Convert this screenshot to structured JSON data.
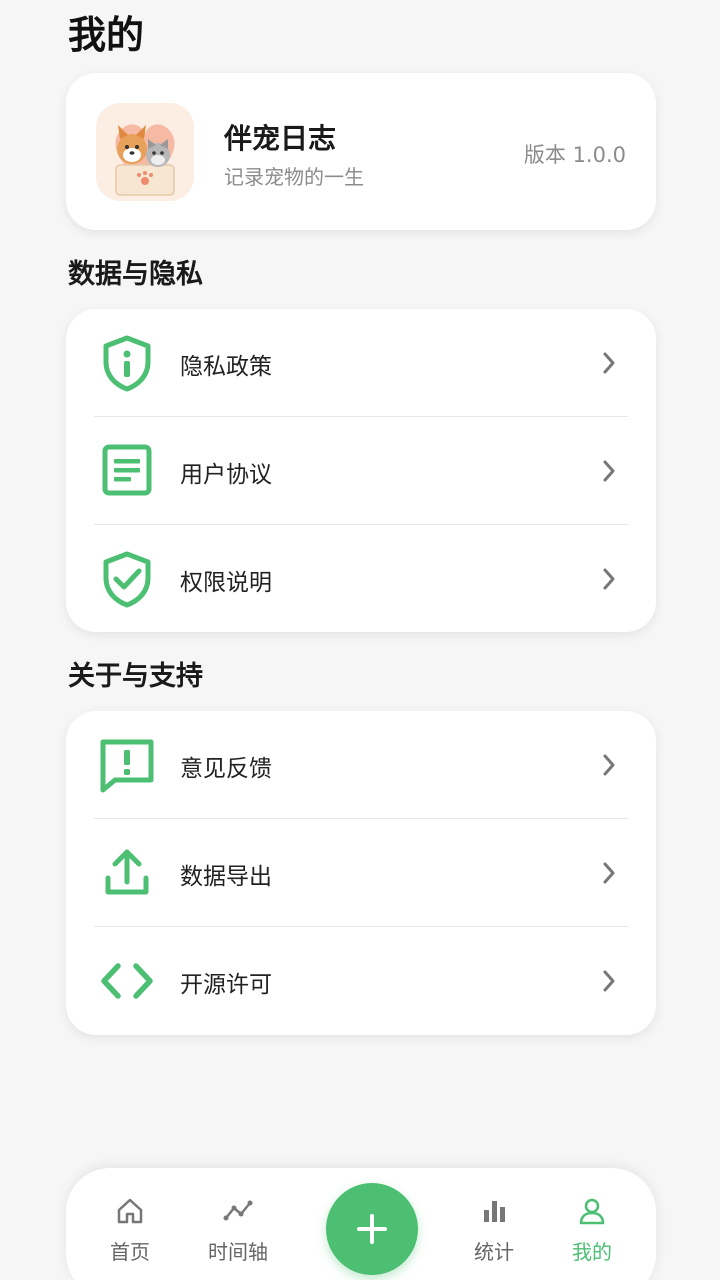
{
  "page": {
    "title": "我的"
  },
  "app_info": {
    "name": "伴宠日志",
    "slogan": "记录宠物的一生",
    "version": "版本 1.0.0"
  },
  "sections": [
    {
      "title": "数据与隐私",
      "items": [
        {
          "label": "隐私政策",
          "icon": "shield-info-icon"
        },
        {
          "label": "用户协议",
          "icon": "document-icon"
        },
        {
          "label": "权限说明",
          "icon": "shield-check-icon"
        }
      ]
    },
    {
      "title": "关于与支持",
      "items": [
        {
          "label": "意见反馈",
          "icon": "feedback-icon"
        },
        {
          "label": "数据导出",
          "icon": "upload-icon"
        },
        {
          "label": "开源许可",
          "icon": "code-icon"
        }
      ]
    }
  ],
  "tabbar": {
    "items": [
      {
        "label": "首页",
        "icon": "home-icon"
      },
      {
        "label": "时间轴",
        "icon": "trend-icon"
      },
      {
        "label": "",
        "icon": "plus-icon"
      },
      {
        "label": "统计",
        "icon": "bar-chart-icon"
      },
      {
        "label": "我的",
        "icon": "user-icon"
      }
    ],
    "active": "我的"
  },
  "colors": {
    "accent": "#4cbf73",
    "background": "#f6f6f6",
    "card": "#ffffff",
    "secondary_text": "#8c8c8c"
  }
}
